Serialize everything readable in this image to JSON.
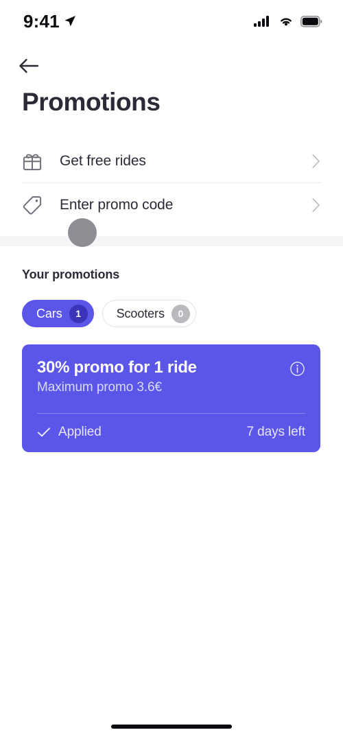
{
  "status_bar": {
    "time": "9:41",
    "location_icon": "location-arrow-icon",
    "signal_icon": "cellular-signal-icon",
    "wifi_icon": "wifi-icon",
    "battery_icon": "battery-full-icon"
  },
  "header": {
    "back_icon": "arrow-left-icon",
    "title": "Promotions"
  },
  "menu": {
    "rows": [
      {
        "label": "Get free rides",
        "icon": "gift-icon",
        "chevron": "chevron-right-icon"
      },
      {
        "label": "Enter promo code",
        "icon": "tag-icon",
        "chevron": "chevron-right-icon"
      }
    ]
  },
  "promotions": {
    "section_title": "Your promotions",
    "chips": [
      {
        "label": "Cars",
        "count": "1",
        "active": true
      },
      {
        "label": "Scooters",
        "count": "0",
        "active": false
      }
    ],
    "card": {
      "title": "30% promo for 1 ride",
      "subtitle": "Maximum promo 3.6€",
      "info_icon": "info-circle-icon",
      "status_icon": "check-icon",
      "status_label": "Applied",
      "expiry_label": "7 days left"
    }
  },
  "colors": {
    "accent": "#5b55e8",
    "accent_dark": "#3b33b8",
    "text_primary": "#2b2b38",
    "badge_gray": "#b9b9be",
    "divider": "#ececed",
    "section_band": "#f5f5f7"
  },
  "cursor": {
    "name": "touch-indicator"
  },
  "home_indicator": {
    "name": "home-indicator"
  }
}
